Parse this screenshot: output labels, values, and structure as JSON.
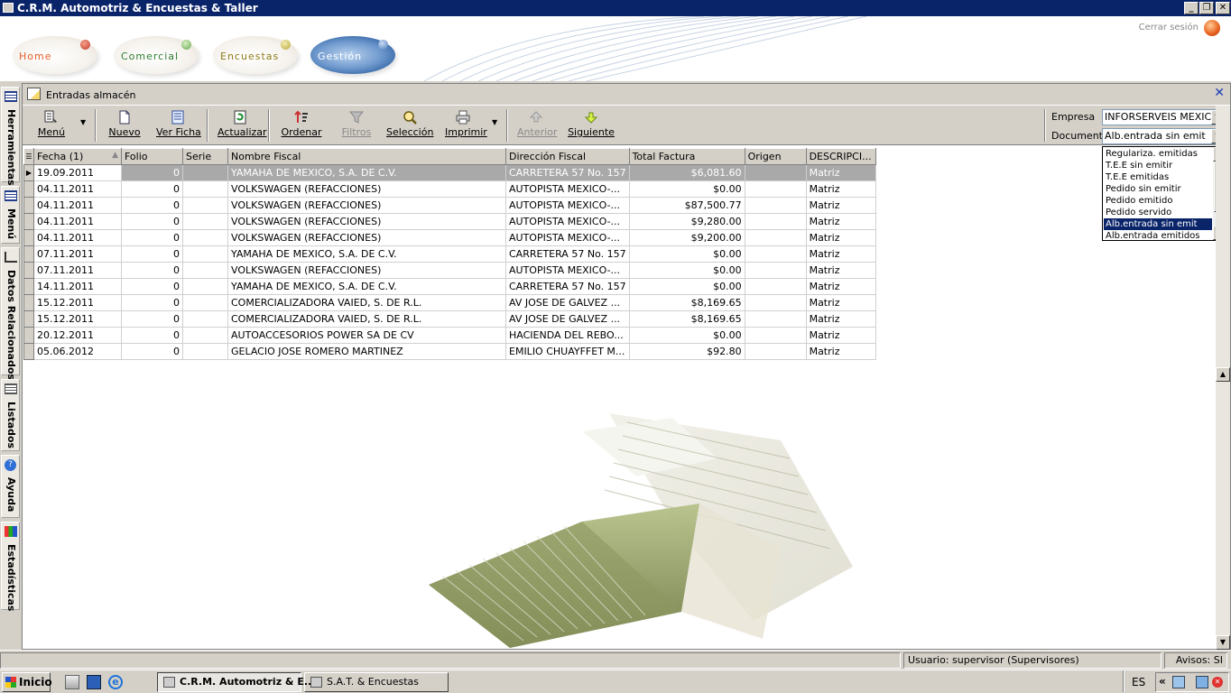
{
  "window": {
    "title": "C.R.M. Automotriz & Encuestas & Taller"
  },
  "nav": {
    "tabs": [
      {
        "label": "Home",
        "color": "#e8602c",
        "dot": "#c0392b"
      },
      {
        "label": "Comercial",
        "color": "#2e7d32",
        "dot": "#6aa84f"
      },
      {
        "label": "Encuestas",
        "color": "#8d7d1a",
        "dot": "#b8a837"
      },
      {
        "label": "Gestión",
        "color": "#ffffff",
        "dot": "#4a78b8"
      }
    ],
    "logout": "Cerrar sesión"
  },
  "sidebar": {
    "items": [
      "Herramientas",
      "Menú",
      "Datos Relacionados",
      "Listados",
      "Ayuda",
      "Estadísticas"
    ]
  },
  "panel": {
    "title": "Entradas almacén"
  },
  "toolbar": {
    "menu": "Menú",
    "nuevo": "Nuevo",
    "ver_ficha": "Ver Ficha",
    "actualizar": "Actualizar",
    "ordenar": "Ordenar",
    "filtros": "Filtros",
    "seleccion": "Selección",
    "imprimir": "Imprimir",
    "anterior": "Anterior",
    "siguiente": "Siguiente"
  },
  "filters": {
    "empresa_label": "Empresa",
    "empresa_value": "INFORSERVEIS MEXIC",
    "documento_label": "Documento",
    "documento_value": "Alb.entrada sin emit",
    "documento_options": [
      "Regulariza. emitidas",
      "T.E.E sin emitir",
      "T.E.E emitidas",
      "Pedido sin emitir",
      "Pedido emitido",
      "Pedido servido",
      "Alb.entrada sin emit",
      "Alb.entrada emitidos"
    ]
  },
  "grid": {
    "columns": [
      "Fecha (1)",
      "Folio",
      "Serie",
      "Nombre Fiscal",
      "Dirección Fiscal",
      "Total Factura",
      "Origen",
      "DESCRIPCI..."
    ],
    "rows": [
      [
        "19.09.2011",
        "0",
        "",
        "YAMAHA DE MEXICO, S.A. DE C.V.",
        "CARRETERA 57 No. 157",
        "$6,081.60",
        "",
        "Matriz"
      ],
      [
        "04.11.2011",
        "0",
        "",
        "VOLKSWAGEN (REFACCIONES)",
        "AUTOPISTA MEXICO-...",
        "$0.00",
        "",
        "Matriz"
      ],
      [
        "04.11.2011",
        "0",
        "",
        "VOLKSWAGEN (REFACCIONES)",
        "AUTOPISTA MEXICO-...",
        "$87,500.77",
        "",
        "Matriz"
      ],
      [
        "04.11.2011",
        "0",
        "",
        "VOLKSWAGEN (REFACCIONES)",
        "AUTOPISTA MEXICO-...",
        "$9,280.00",
        "",
        "Matriz"
      ],
      [
        "04.11.2011",
        "0",
        "",
        "VOLKSWAGEN (REFACCIONES)",
        "AUTOPISTA MEXICO-...",
        "$9,200.00",
        "",
        "Matriz"
      ],
      [
        "07.11.2011",
        "0",
        "",
        "YAMAHA DE MEXICO, S.A. DE C.V.",
        "CARRETERA 57 No. 157",
        "$0.00",
        "",
        "Matriz"
      ],
      [
        "07.11.2011",
        "0",
        "",
        "VOLKSWAGEN (REFACCIONES)",
        "AUTOPISTA MEXICO-...",
        "$0.00",
        "",
        "Matriz"
      ],
      [
        "14.11.2011",
        "0",
        "",
        "YAMAHA DE MEXICO, S.A. DE C.V.",
        "CARRETERA 57 No. 157",
        "$0.00",
        "",
        "Matriz"
      ],
      [
        "15.12.2011",
        "0",
        "",
        "COMERCIALIZADORA VAIED, S. DE R.L.",
        "AV JOSE DE GALVEZ ...",
        "$8,169.65",
        "",
        "Matriz"
      ],
      [
        "15.12.2011",
        "0",
        "",
        "COMERCIALIZADORA VAIED, S. DE R.L.",
        "AV JOSE DE GALVEZ ...",
        "$8,169.65",
        "",
        "Matriz"
      ],
      [
        "20.12.2011",
        "0",
        "",
        "AUTOACCESORIOS POWER SA DE CV",
        "HACIENDA DEL REBO...",
        "$0.00",
        "",
        "Matriz"
      ],
      [
        "05.06.2012",
        "0",
        "",
        "GELACIO JOSE ROMERO MARTINEZ",
        "EMILIO CHUAYFFET M...",
        "$92.80",
        "",
        "Matriz"
      ]
    ]
  },
  "status": {
    "user": "Usuario: supervisor (Supervisores)",
    "avisos": "Avisos: SI"
  },
  "taskbar": {
    "start": "Inicio",
    "tasks": [
      "C.R.M. Automotriz & E...",
      "S.A.T. & Encuestas"
    ],
    "lang": "ES"
  }
}
